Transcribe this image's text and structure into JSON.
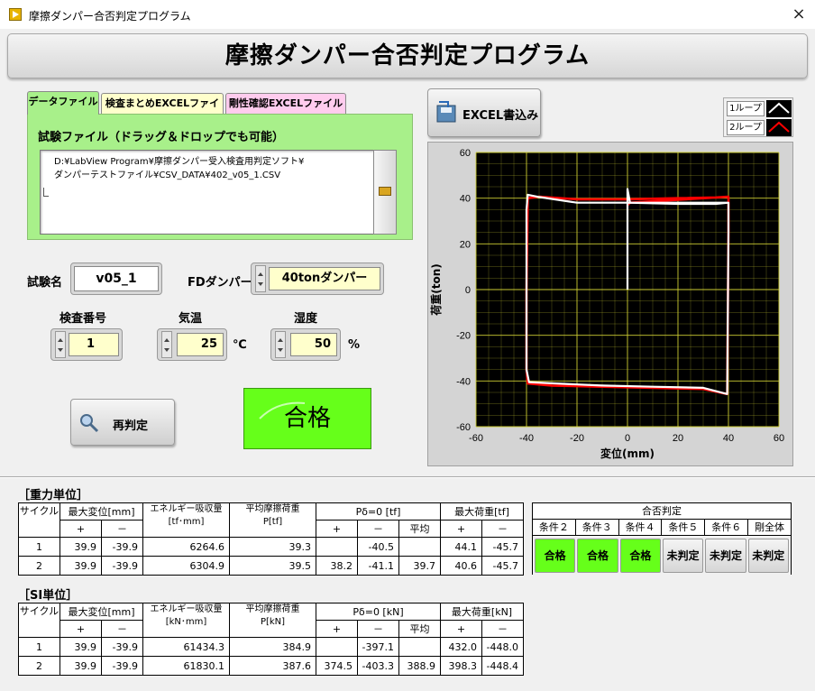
{
  "window": {
    "title": "摩擦ダンパー合否判定プログラム",
    "close_icon": "×"
  },
  "header": {
    "title": "摩擦ダンパー合否判定プログラム"
  },
  "tabs": [
    {
      "label": "データファイル",
      "color": "#a8f08a"
    },
    {
      "label": "検査まとめEXCELファイル",
      "color": "#ffffcc"
    },
    {
      "label": "剛性確認EXCELファイル",
      "color": "#ffccee"
    }
  ],
  "file": {
    "label": "試験ファイル（ドラッグ＆ドロップでも可能）",
    "path": "D:¥LabView Program¥摩擦ダンパー受入検査用判定ソフト¥\nダンパーテストファイル¥CSV_DATA¥402_v05_1.CSV"
  },
  "test_name": {
    "label": "試験名",
    "value": "v05_1"
  },
  "fd_damper": {
    "label": "FDダンパー",
    "value": "40tonダンパー"
  },
  "inspection_no": {
    "label": "検査番号",
    "value": "1"
  },
  "temperature": {
    "label": "気温",
    "value": "25",
    "unit": "℃"
  },
  "humidity": {
    "label": "湿度",
    "value": "50",
    "unit": "%"
  },
  "rejudge_button": {
    "label": "再判定"
  },
  "result": {
    "label": "合格",
    "color": "#66ff1a"
  },
  "excel_button": {
    "label": "EXCEL書込み"
  },
  "legend": [
    {
      "name": "1ループ",
      "color": "#ffffff"
    },
    {
      "name": "2ループ",
      "color": "#ff0000"
    }
  ],
  "chart_data": {
    "type": "line",
    "xlabel": "変位(mm)",
    "ylabel": "荷重(ton)",
    "xlim": [
      -60,
      60
    ],
    "ylim": [
      -60,
      60
    ],
    "xticks": [
      -60,
      -40,
      -20,
      0,
      20,
      40,
      60
    ],
    "yticks": [
      -60,
      -40,
      -20,
      0,
      20,
      40,
      60
    ],
    "grid": true,
    "background": "#000000",
    "grid_color": "#cccc33",
    "series": [
      {
        "name": "1ループ",
        "color": "#ffffff",
        "x": [
          0,
          0,
          0,
          1,
          40,
          40,
          39.5,
          30,
          10,
          -10,
          -30,
          -39,
          -40,
          -40,
          -40,
          -39.5,
          -35,
          -20,
          0,
          20,
          35,
          40
        ],
        "y": [
          0,
          20,
          44,
          38,
          38,
          25,
          -45.7,
          -43,
          -42.5,
          -42,
          -41,
          -40.5,
          -35,
          0,
          35,
          41.5,
          40.5,
          38,
          38,
          37.5,
          37.5,
          38
        ]
      },
      {
        "name": "2ループ",
        "color": "#ff0000",
        "x": [
          0,
          1,
          40,
          40,
          39.5,
          30,
          10,
          -10,
          -30,
          -39.5,
          -40,
          -40,
          -39.5,
          -35,
          -20,
          0,
          20,
          35,
          40
        ],
        "y": [
          37,
          38,
          40.6,
          25,
          -45.7,
          -43.5,
          -43,
          -42.5,
          -42,
          -41.1,
          -35,
          0,
          40,
          40.6,
          39.5,
          39.5,
          40,
          40.3,
          40.6
        ]
      }
    ]
  },
  "gravity_section": {
    "title": "［重力単位］",
    "headers": {
      "cycle": "サイクル",
      "max_disp": "最大変位[mm]",
      "energy": "エネルギー吸収量\n[tf･mm]",
      "avg_friction": "平均摩擦荷重\nP[tf]",
      "p_delta": "Pδ=0 [tf]",
      "max_load": "最大荷重[tf]",
      "plus": "+",
      "minus": "－",
      "avg": "平均",
      "judge": "合否判定"
    },
    "conditions": [
      "条件２",
      "条件３",
      "条件４",
      "条件５",
      "条件６",
      "剛全体"
    ],
    "judgements": [
      {
        "label": "合格",
        "state": "pass"
      },
      {
        "label": "合格",
        "state": "pass"
      },
      {
        "label": "合格",
        "state": "pass"
      },
      {
        "label": "未判定",
        "state": "none"
      },
      {
        "label": "未判定",
        "state": "none"
      },
      {
        "label": "未判定",
        "state": "none"
      }
    ],
    "rows": [
      {
        "cycle": "1",
        "disp_plus": "39.9",
        "disp_minus": "-39.9",
        "energy": "6264.6",
        "avg": "39.3",
        "pd_plus": "",
        "pd_minus": "-40.5",
        "pd_avg": "",
        "load_plus": "44.1",
        "load_minus": "-45.7"
      },
      {
        "cycle": "2",
        "disp_plus": "39.9",
        "disp_minus": "-39.9",
        "energy": "6304.9",
        "avg": "39.5",
        "pd_plus": "38.2",
        "pd_minus": "-41.1",
        "pd_avg": "39.7",
        "load_plus": "40.6",
        "load_minus": "-45.7"
      }
    ]
  },
  "si_section": {
    "title": "［SI単位］",
    "headers": {
      "cycle": "サイクル",
      "max_disp": "最大変位[mm]",
      "energy": "エネルギー吸収量\n[kN･mm]",
      "avg_friction": "平均摩擦荷重\nP[kN]",
      "p_delta": "Pδ=0 [kN]",
      "max_load": "最大荷重[kN]",
      "plus": "+",
      "minus": "－",
      "avg": "平均"
    },
    "rows": [
      {
        "cycle": "1",
        "disp_plus": "39.9",
        "disp_minus": "-39.9",
        "energy": "61434.3",
        "avg": "384.9",
        "pd_plus": "",
        "pd_minus": "-397.1",
        "pd_avg": "",
        "load_plus": "432.0",
        "load_minus": "-448.0"
      },
      {
        "cycle": "2",
        "disp_plus": "39.9",
        "disp_minus": "-39.9",
        "energy": "61830.1",
        "avg": "387.6",
        "pd_plus": "374.5",
        "pd_minus": "-403.3",
        "pd_avg": "388.9",
        "load_plus": "398.3",
        "load_minus": "-448.4"
      }
    ]
  }
}
